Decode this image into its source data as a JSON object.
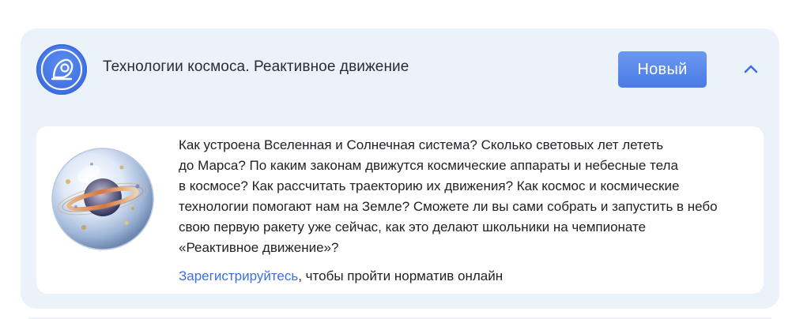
{
  "course": {
    "title": "Технологии космоса. Реактивное движение",
    "badge": "Новый",
    "icon": "rocket-helmet-icon",
    "toggle_icon": "chevron-up-icon",
    "illustration": "planet-in-glass-sphere",
    "description_lines": [
      "Как устроена Вселенная и Солнечная система? Сколько световых лет лететь",
      "до Марса? По каким законам движутся космические аппараты и небесные тела",
      "в космосе? Как рассчитать траекторию их движения? Как космос и космические",
      "технологии помогают нам на Земле? Сможете ли вы сами собрать и запустить в небо",
      "свою первую ракету уже сейчас, как это делают школьники на чемпионате",
      "«Реактивное движение»?"
    ],
    "cta_link": "Зарегистрируйтесь",
    "cta_rest": ", чтобы пройти норматив онлайн"
  },
  "colors": {
    "card_bg": "#ebf2fa",
    "accent": "#4a7be6",
    "link": "#3d6fe0",
    "text": "#1e2026"
  }
}
